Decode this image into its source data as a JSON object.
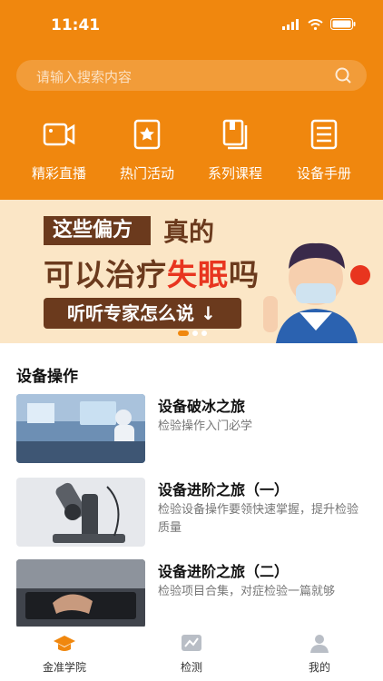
{
  "status": {
    "time": "11:41"
  },
  "search": {
    "placeholder": "请输入搜索内容"
  },
  "quick_actions": [
    {
      "label": "精彩直播",
      "icon": "video-camera-icon"
    },
    {
      "label": "热门活动",
      "icon": "star-card-icon"
    },
    {
      "label": "系列课程",
      "icon": "book-stack-icon"
    },
    {
      "label": "设备手册",
      "icon": "manual-icon"
    }
  ],
  "banner": {
    "line1a": "这些偏方",
    "line1b": "真的",
    "line2a": "可以治疗",
    "line2b": "失眠",
    "line2c": "吗",
    "button": "听听专家怎么说 ↓"
  },
  "section": {
    "title": "设备操作"
  },
  "courses": [
    {
      "title": "设备破冰之旅",
      "desc": "检验操作入门必学"
    },
    {
      "title": "设备进阶之旅（一）",
      "desc": "检验设备操作要领快速掌握，提升检验质量"
    },
    {
      "title": "设备进阶之旅（二）",
      "desc": "检验项目合集，对症检验一篇就够"
    }
  ],
  "tabs": [
    {
      "label": "金准学院",
      "icon": "graduation-cap-icon",
      "active": true
    },
    {
      "label": "检测",
      "icon": "chart-icon",
      "active": false
    },
    {
      "label": "我的",
      "icon": "user-icon",
      "active": false
    }
  ],
  "colors": {
    "accent": "#f0870e",
    "banner_dark": "#6b3a1d",
    "banner_red": "#e8351f"
  }
}
